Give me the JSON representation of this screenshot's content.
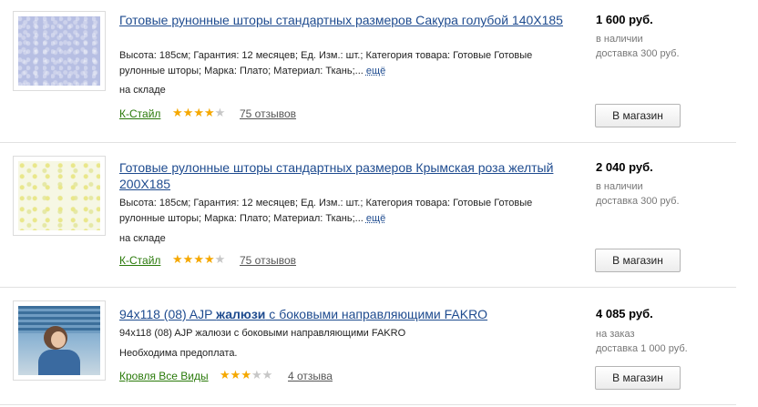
{
  "products": [
    {
      "title": "Готовые рунонные шторы стандартных размеров Сакура голубой 140Х185",
      "desc": "Высота: 185см; Гарантия: 12 месяцев; Ед. Изм.: шт.; Категория товара: Готовые Готовые рулонные шторы; Марка: Плато; Материал: Ткань;...",
      "more": "ещё",
      "stock": "на складе",
      "shop": "К-Стайл",
      "stars": "★★★★★",
      "rating": 4,
      "reviews": "75 отзывов",
      "price": "1 600 руб.",
      "availability": "в наличии",
      "delivery": "доставка 300 руб.",
      "button": "В магазин",
      "thumb_icon": "blue-fabric-thumbnail"
    },
    {
      "title": "Готовые рулонные шторы стандартных размеров Крымская роза желтый 200Х185",
      "desc": "Высота: 185см; Гарантия: 12 месяцев; Ед. Изм.: шт.; Категория товара: Готовые Готовые рулонные шторы; Марка: Плато; Материал: Ткань;...",
      "more": "ещё",
      "stock": "на складе",
      "shop": "К-Стайл",
      "stars": "★★★★★",
      "rating": 4,
      "reviews": "75 отзывов",
      "price": "2 040 руб.",
      "availability": "в наличии",
      "delivery": "доставка 300 руб.",
      "button": "В магазин",
      "thumb_icon": "yellow-fabric-thumbnail"
    },
    {
      "title_prefix": "94x118 (08) AJP ",
      "title_bold": "жалюзи",
      "title_suffix": " с боковыми направляющими FAKRO",
      "desc": "94x118 (08) AJP жалюзи с боковыми направляющими FAKRO",
      "stock": "Необходима предоплата.",
      "shop": "Кровля Все Виды",
      "stars": "★★★★★",
      "rating": 3,
      "reviews": "4 отзыва",
      "price": "4 085 руб.",
      "availability": "на заказ",
      "delivery": "доставка 1 000 руб.",
      "button": "В магазин",
      "thumb_icon": "window-blinds-photo-thumbnail"
    }
  ]
}
